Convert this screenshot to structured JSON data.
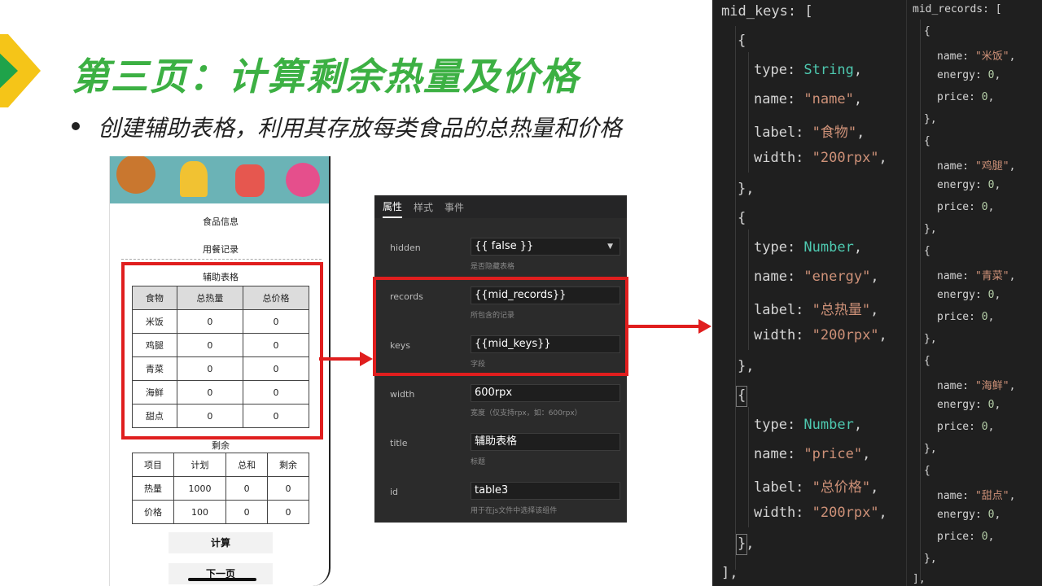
{
  "slide": {
    "title": "第三页：计算剩余热量及价格",
    "bullet": "创建辅助表格，利用其存放每类食品的总热量和价格"
  },
  "phone": {
    "label_food_info": "食品信息",
    "label_meal_record": "用餐记录",
    "aux_table": {
      "title": "辅助表格",
      "headers": [
        "食物",
        "总热量",
        "总价格"
      ],
      "rows": [
        [
          "米饭",
          "0",
          "0"
        ],
        [
          "鸡腿",
          "0",
          "0"
        ],
        [
          "青菜",
          "0",
          "0"
        ],
        [
          "海鲜",
          "0",
          "0"
        ],
        [
          "甜点",
          "0",
          "0"
        ]
      ]
    },
    "remain_table": {
      "title": "剩余",
      "headers": [
        "项目",
        "计划",
        "总和",
        "剩余"
      ],
      "rows": [
        [
          "热量",
          "1000",
          "0",
          "0"
        ],
        [
          "价格",
          "100",
          "0",
          "0"
        ]
      ]
    },
    "calc_button": "计算",
    "next_button": "下一页"
  },
  "panel": {
    "tabs": [
      "属性",
      "样式",
      "事件"
    ],
    "props": [
      {
        "name": "hidden",
        "value": "{{ false }}",
        "desc": "是否隐藏表格"
      },
      {
        "name": "records",
        "value": "{{mid_records}}",
        "desc": "所包含的记录"
      },
      {
        "name": "keys",
        "value": "{{mid_keys}}",
        "desc": "字段"
      },
      {
        "name": "width",
        "value": "600rpx",
        "desc": "宽度（仅支持rpx，如：600rpx）"
      },
      {
        "name": "title",
        "value": "辅助表格",
        "desc": "标题"
      },
      {
        "name": "id",
        "value": "table3",
        "desc": "用于在js文件中选择该组件"
      }
    ]
  },
  "code_keys": {
    "header": "mid_keys",
    "items": [
      {
        "type": "String",
        "name": "\"name\"",
        "label": "\"食物\"",
        "width": "\"200rpx\""
      },
      {
        "type": "Number",
        "name": "\"energy\"",
        "label": "\"总热量\"",
        "width": "\"200rpx\""
      },
      {
        "type": "Number",
        "name": "\"price\"",
        "label": "\"总价格\"",
        "width": "\"200rpx\""
      }
    ]
  },
  "code_records": {
    "header": "mid_records",
    "items": [
      {
        "name": "\"米饭\"",
        "energy": "0",
        "price": "0"
      },
      {
        "name": "\"鸡腿\"",
        "energy": "0",
        "price": "0"
      },
      {
        "name": "\"青菜\"",
        "energy": "0",
        "price": "0"
      },
      {
        "name": "\"海鲜\"",
        "energy": "0",
        "price": "0"
      },
      {
        "name": "\"甜点\"",
        "energy": "0",
        "price": "0"
      }
    ]
  },
  "colors": {
    "title_green": "#3cb043",
    "highlight_red": "#e01e1e",
    "code_bg": "#1f1f1f",
    "code_type": "#4ec9b0",
    "code_string": "#ce9178",
    "code_number": "#b5cea8"
  }
}
